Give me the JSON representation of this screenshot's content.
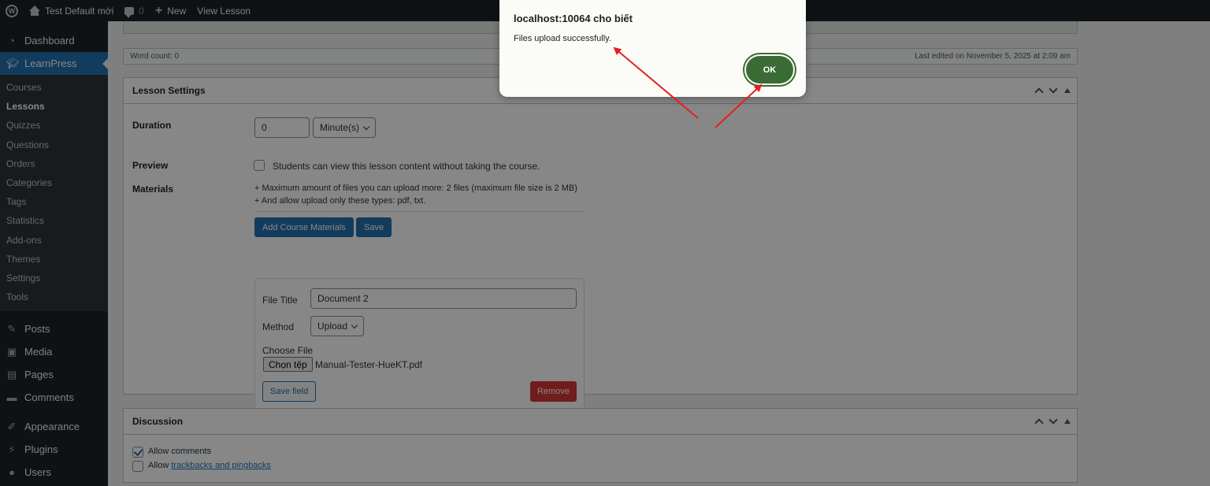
{
  "adminbar": {
    "site_name": "Test Default mới",
    "comments_count": "0",
    "new_label": "New",
    "view_label": "View Lesson"
  },
  "sidebar": {
    "dashboard": "Dashboard",
    "learnpress": "LearnPress",
    "submenu": [
      "Courses",
      "Lessons",
      "Quizzes",
      "Questions",
      "Orders",
      "Categories",
      "Tags",
      "Statistics",
      "Add-ons",
      "Themes",
      "Settings",
      "Tools"
    ],
    "current_submenu": "Lessons",
    "posts": "Posts",
    "media": "Media",
    "pages": "Pages",
    "comments": "Comments",
    "appearance": "Appearance",
    "plugins": "Plugins",
    "users": "Users"
  },
  "editor": {
    "word_count": "Word count: 0",
    "last_edited": "Last edited on November 5, 2025 at 2:09 am"
  },
  "lesson_settings": {
    "title": "Lesson Settings",
    "duration_label": "Duration",
    "duration_value": "0",
    "duration_unit": "Minute(s)",
    "preview_label": "Preview",
    "preview_text": "Students can view this lesson content without taking the course.",
    "preview_checked": false,
    "materials_label": "Materials",
    "materials_info_1": "+ Maximum amount of files you can upload more: 2 files (maximum file size is 2 MB)",
    "materials_info_2": "+ And allow upload only these types: pdf, txt.",
    "add_materials_button": "Add Course Materials",
    "save_button": "Save",
    "field": {
      "file_title_label": "File Title",
      "file_title_value": "Document 2",
      "method_label": "Method",
      "method_value": "Upload",
      "choose_file_label": "Choose File",
      "choose_file_button": "Chọn tệp",
      "chosen_file": "Manual-Tester-HueKT.pdf",
      "save_field_button": "Save field",
      "remove_button": "Remove"
    }
  },
  "discussion": {
    "title": "Discussion",
    "allow_comments": "Allow comments",
    "allow_comments_checked": true,
    "allow_prefix": "Allow",
    "trackbacks_link": "trackbacks and pingbacks",
    "trackbacks_checked": false
  },
  "dialog": {
    "title": "localhost:10064 cho biết",
    "message": "Files upload successfully.",
    "ok_button": "OK"
  },
  "colors": {
    "admin_dark": "#1d2327",
    "wp_blue": "#2271b1",
    "remove_red": "#d63638",
    "ok_green": "#3a6b35",
    "annotation_red": "#e81e1e"
  }
}
